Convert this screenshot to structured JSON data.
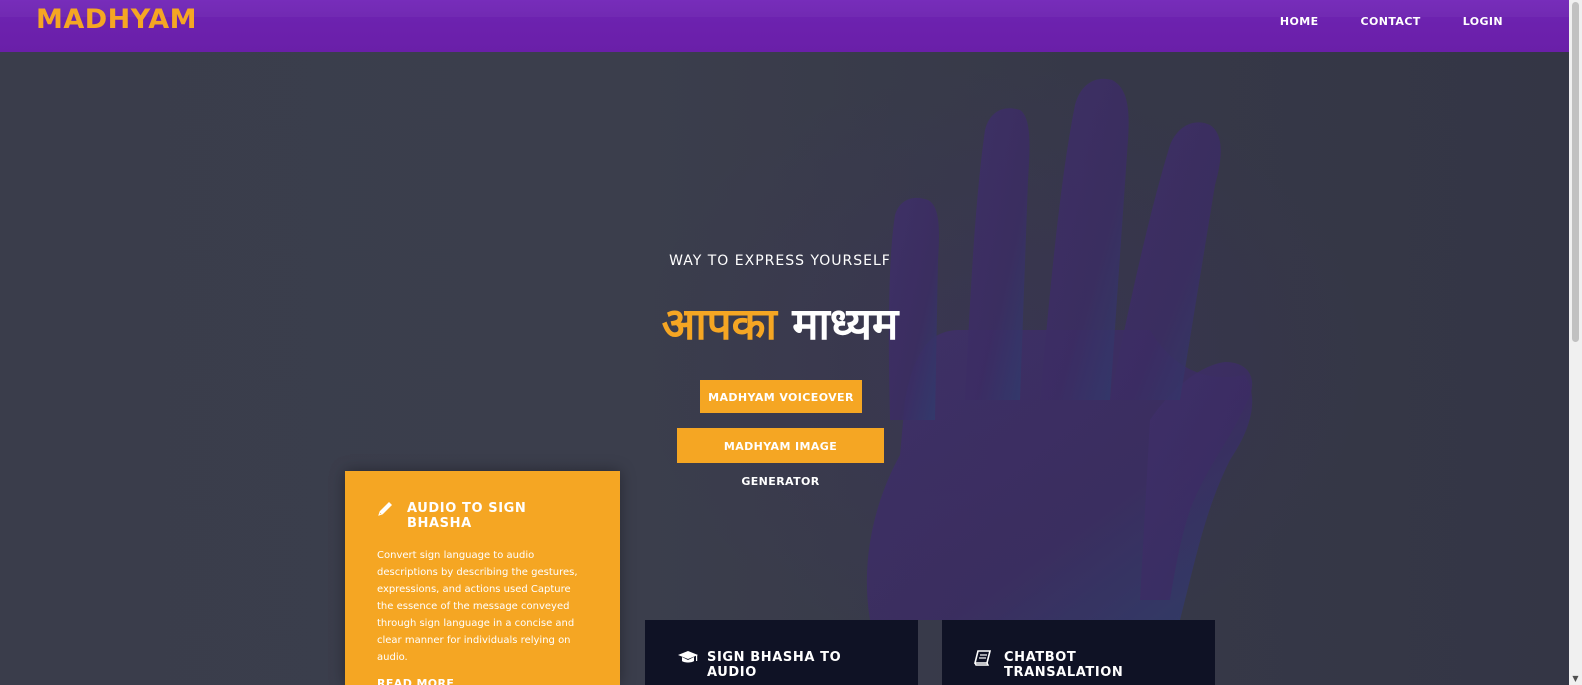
{
  "navbar": {
    "brand": "MADHYAM",
    "links": [
      {
        "label": "HOME"
      },
      {
        "label": "CONTACT"
      },
      {
        "label": "LOGIN"
      }
    ]
  },
  "hero": {
    "subtitle": "WAY TO EXPRESS YOURSELF",
    "title_part1": "आपका",
    "title_part2": "माध्यम",
    "buttons": {
      "voiceover": "MADHYAM VOICEOVER",
      "image_generator": "MADHYAM IMAGE GENERATOR"
    }
  },
  "cards": [
    {
      "title": "AUDIO TO SIGN BHASHA",
      "icon": "pencil-icon",
      "description": "Convert sign language to audio descriptions by describing the gestures, expressions, and actions used Capture the essence of the message conveyed through sign language in a concise and clear manner for individuals relying on audio.",
      "link_label": "READ MORE"
    },
    {
      "title": "SIGN BHASHA TO AUDIO",
      "icon": "graduation-cap-icon"
    },
    {
      "title": "CHATBOT TRANSALATION",
      "icon": "book-icon"
    }
  ],
  "colors": {
    "accent": "#f5a623",
    "navbar": "#6d22b0",
    "dark_card": "#0f1225",
    "background": "#393c4a"
  }
}
